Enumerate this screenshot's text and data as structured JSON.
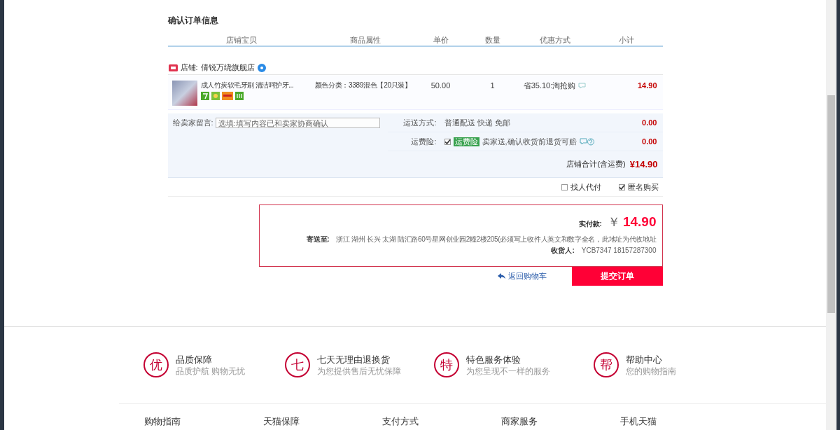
{
  "section_title": "确认订单信息",
  "table": {
    "columns": [
      "店铺宝贝",
      "商品属性",
      "单价",
      "数量",
      "优惠方式",
      "小计"
    ]
  },
  "shop": {
    "label": "店铺:",
    "name": "倩锐万绕旗舰店"
  },
  "item": {
    "title": "成人竹炭软毛牙刷 清洁呵护牙...",
    "attribute": "颜色分类：3389混色【20只装】",
    "price": "50.00",
    "quantity": "1",
    "promotion": "省35.10:淘抢购",
    "subtotal": "14.90"
  },
  "message": {
    "label": "给卖家留言:",
    "placeholder": "选填:填写内容已和卖家协商确认"
  },
  "shipping": {
    "label": "运送方式:",
    "value": "普通配送 快递 免邮",
    "amount": "0.00"
  },
  "insurance": {
    "label": "运费险:",
    "checked": true,
    "tag": "运费险",
    "text": "卖家送,确认收货前退货可赔",
    "amount": "0.00"
  },
  "shop_total": {
    "label": "店铺合计(含运费)",
    "value": "¥14.90"
  },
  "order_options": [
    {
      "label": "找人代付",
      "checked": false
    },
    {
      "label": "匿名购买",
      "checked": true
    }
  ],
  "payment": {
    "label": "实付款:",
    "currency": "￥",
    "amount": "14.90",
    "address_label": "寄送至:",
    "address": "浙江 湖州 长兴 太湖 陆汇路60号星网创业园2幢2楼205(必须写上收件人英文和数字全名，此地址为代收地址",
    "recipient_label": "收货人:",
    "recipient": "YCB7347 18157287300"
  },
  "back_link": "返回购物车",
  "submit_button": "提交订单",
  "guarantees": [
    {
      "icon": "优",
      "title": "品质保障",
      "subtitle": "品质护航 购物无忧"
    },
    {
      "icon": "七",
      "title": "七天无理由退换货",
      "subtitle": "为您提供售后无忧保障"
    },
    {
      "icon": "特",
      "title": "特色服务体验",
      "subtitle": "为您呈现不一样的服务"
    },
    {
      "icon": "帮",
      "title": "帮助中心",
      "subtitle": "您的购物指南"
    }
  ],
  "footer_links": [
    "购物指南",
    "天猫保障",
    "支付方式",
    "商家服务",
    "手机天猫"
  ]
}
